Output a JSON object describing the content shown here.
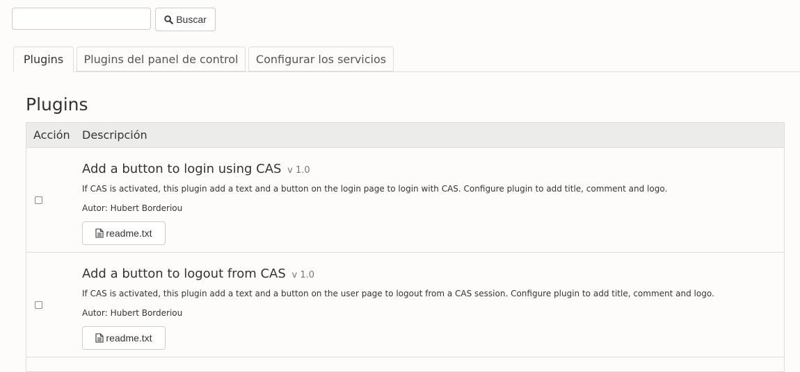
{
  "search": {
    "placeholder": "",
    "value": "",
    "button_label": "Buscar",
    "icon": "search-icon"
  },
  "tabs": [
    {
      "label": "Plugins",
      "active": true
    },
    {
      "label": "Plugins del panel de control",
      "active": false
    },
    {
      "label": "Configurar los servicios",
      "active": false
    }
  ],
  "page_title": "Plugins",
  "table": {
    "headers": {
      "action": "Acción",
      "description": "Descripción"
    },
    "author_label": "Autor:",
    "rows": [
      {
        "checked": false,
        "title": "Add a button to login using CAS",
        "version": "v 1.0",
        "description": "If CAS is activated, this plugin add a text and a button on the login page to login with CAS. Configure plugin to add title, comment and logo.",
        "author": "Hubert Borderiou",
        "readme_label": "readme.txt",
        "readme_icon": "file-text-icon"
      },
      {
        "checked": false,
        "title": "Add a button to logout from CAS",
        "version": "v 1.0",
        "description": "If CAS is activated, this plugin add a text and a button on the user page to logout from a CAS session. Configure plugin to add title, comment and logo.",
        "author": "Hubert Borderiou",
        "readme_label": "readme.txt",
        "readme_icon": "file-text-icon"
      }
    ]
  }
}
